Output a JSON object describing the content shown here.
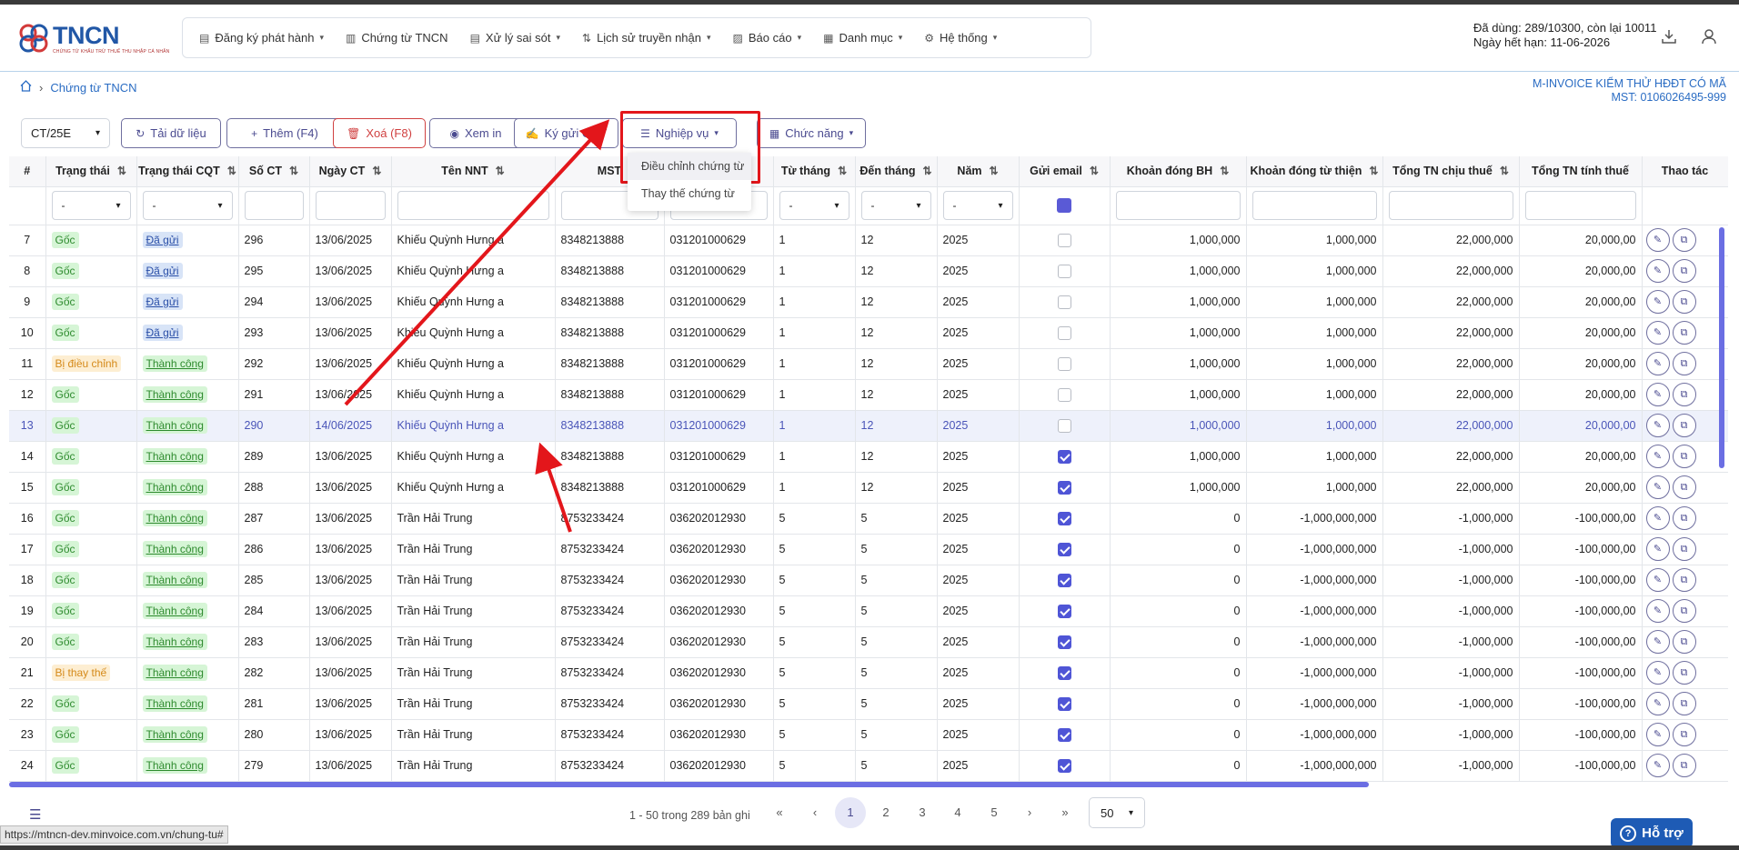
{
  "logo": {
    "text": "TNCN",
    "tagline": "CHỨNG TỪ KHẤU TRỪ THUẾ THU NHẬP CÁ NHÂN"
  },
  "nav": [
    {
      "label": "Đăng ký phát hành",
      "icon": "file-icon",
      "chevron": true
    },
    {
      "label": "Chứng từ TNCN",
      "icon": "document-icon",
      "chevron": false
    },
    {
      "label": "Xử lý sai sót",
      "icon": "file-icon",
      "chevron": true
    },
    {
      "label": "Lịch sử truyền nhận",
      "icon": "transfer-icon",
      "chevron": true
    },
    {
      "label": "Báo cáo",
      "icon": "chart-icon",
      "chevron": true
    },
    {
      "label": "Danh mục",
      "icon": "grid-icon",
      "chevron": true
    },
    {
      "label": "Hệ thống",
      "icon": "gear-icon",
      "chevron": true
    }
  ],
  "usage": {
    "line1": "Đã dùng: 289/10300, còn lại 10011",
    "line2": "Ngày hết hạn: 11-06-2026"
  },
  "breadcrumb": {
    "current": "Chứng từ TNCN"
  },
  "company": {
    "name": "M-INVOICE KIỂM THỬ HĐĐT CÓ MÃ",
    "mst": "MST: 0106026495-999"
  },
  "toolbar": {
    "type_select": "CT/25E",
    "reload": "Tải dữ liệu",
    "add": "Thêm (F4)",
    "delete": "Xoá (F8)",
    "print": "Xem in",
    "sign_send": "Ký gửi CQT",
    "business": "Nghiệp vụ",
    "functions": "Chức năng"
  },
  "dropdown": {
    "items": [
      "Điều chỉnh chứng từ",
      "Thay thế chứng từ"
    ]
  },
  "columns": [
    "#",
    "Trạng thái",
    "Trạng thái CQT",
    "Số CT",
    "Ngày CT",
    "Tên NNT",
    "MST",
    "",
    "Từ tháng",
    "Đến tháng",
    "Năm",
    "Gửi email",
    "Khoản đóng BH",
    "Khoản đóng từ thiện",
    "Tổng TN chịu thuế",
    "Tổng TN tính thuế",
    "Thao tác"
  ],
  "filter_placeholder": "-",
  "rows": [
    {
      "no": "7",
      "status": "Gốc",
      "cqt": "Đã gửi",
      "so": "296",
      "ngay": "13/06/2025",
      "ten": "Khiếu Quỳnh Hưng a",
      "mst": "8348213888",
      "cccd": "031201000629",
      "tu": "1",
      "den": "12",
      "nam": "2025",
      "email": false,
      "bh": "1,000,000",
      "tt": "1,000,000",
      "chiu": "22,000,000",
      "tinh": "20,000,00"
    },
    {
      "no": "8",
      "status": "Gốc",
      "cqt": "Đã gửi",
      "so": "295",
      "ngay": "13/06/2025",
      "ten": "Khiếu Quỳnh Hưng a",
      "mst": "8348213888",
      "cccd": "031201000629",
      "tu": "1",
      "den": "12",
      "nam": "2025",
      "email": false,
      "bh": "1,000,000",
      "tt": "1,000,000",
      "chiu": "22,000,000",
      "tinh": "20,000,00"
    },
    {
      "no": "9",
      "status": "Gốc",
      "cqt": "Đã gửi",
      "so": "294",
      "ngay": "13/06/2025",
      "ten": "Khiếu Quỳnh Hưng a",
      "mst": "8348213888",
      "cccd": "031201000629",
      "tu": "1",
      "den": "12",
      "nam": "2025",
      "email": false,
      "bh": "1,000,000",
      "tt": "1,000,000",
      "chiu": "22,000,000",
      "tinh": "20,000,00"
    },
    {
      "no": "10",
      "status": "Gốc",
      "cqt": "Đã gửi",
      "so": "293",
      "ngay": "13/06/2025",
      "ten": "Khiếu Quỳnh Hưng a",
      "mst": "8348213888",
      "cccd": "031201000629",
      "tu": "1",
      "den": "12",
      "nam": "2025",
      "email": false,
      "bh": "1,000,000",
      "tt": "1,000,000",
      "chiu": "22,000,000",
      "tinh": "20,000,00"
    },
    {
      "no": "11",
      "status": "Bị điều chỉnh",
      "cqt": "Thành công",
      "so": "292",
      "ngay": "13/06/2025",
      "ten": "Khiếu Quỳnh Hưng a",
      "mst": "8348213888",
      "cccd": "031201000629",
      "tu": "1",
      "den": "12",
      "nam": "2025",
      "email": false,
      "bh": "1,000,000",
      "tt": "1,000,000",
      "chiu": "22,000,000",
      "tinh": "20,000,00"
    },
    {
      "no": "12",
      "status": "Gốc",
      "cqt": "Thành công",
      "so": "291",
      "ngay": "13/06/2025",
      "ten": "Khiếu Quỳnh Hưng a",
      "mst": "8348213888",
      "cccd": "031201000629",
      "tu": "1",
      "den": "12",
      "nam": "2025",
      "email": false,
      "bh": "1,000,000",
      "tt": "1,000,000",
      "chiu": "22,000,000",
      "tinh": "20,000,00"
    },
    {
      "no": "13",
      "status": "Gốc",
      "cqt": "Thành công",
      "so": "290",
      "ngay": "14/06/2025",
      "ten": "Khiếu Quỳnh Hưng a",
      "mst": "8348213888",
      "cccd": "031201000629",
      "tu": "1",
      "den": "12",
      "nam": "2025",
      "email": false,
      "bh": "1,000,000",
      "tt": "1,000,000",
      "chiu": "22,000,000",
      "tinh": "20,000,00",
      "selected": true
    },
    {
      "no": "14",
      "status": "Gốc",
      "cqt": "Thành công",
      "so": "289",
      "ngay": "13/06/2025",
      "ten": "Khiếu Quỳnh Hưng a",
      "mst": "8348213888",
      "cccd": "031201000629",
      "tu": "1",
      "den": "12",
      "nam": "2025",
      "email": true,
      "bh": "1,000,000",
      "tt": "1,000,000",
      "chiu": "22,000,000",
      "tinh": "20,000,00"
    },
    {
      "no": "15",
      "status": "Gốc",
      "cqt": "Thành công",
      "so": "288",
      "ngay": "13/06/2025",
      "ten": "Khiếu Quỳnh Hưng a",
      "mst": "8348213888",
      "cccd": "031201000629",
      "tu": "1",
      "den": "12",
      "nam": "2025",
      "email": true,
      "bh": "1,000,000",
      "tt": "1,000,000",
      "chiu": "22,000,000",
      "tinh": "20,000,00"
    },
    {
      "no": "16",
      "status": "Gốc",
      "cqt": "Thành công",
      "so": "287",
      "ngay": "13/06/2025",
      "ten": "Trần Hải Trung",
      "mst": "8753233424",
      "cccd": "036202012930",
      "tu": "5",
      "den": "5",
      "nam": "2025",
      "email": true,
      "bh": "0",
      "tt": "-1,000,000,000",
      "chiu": "-1,000,000",
      "tinh": "-100,000,00"
    },
    {
      "no": "17",
      "status": "Gốc",
      "cqt": "Thành công",
      "so": "286",
      "ngay": "13/06/2025",
      "ten": "Trần Hải Trung",
      "mst": "8753233424",
      "cccd": "036202012930",
      "tu": "5",
      "den": "5",
      "nam": "2025",
      "email": true,
      "bh": "0",
      "tt": "-1,000,000,000",
      "chiu": "-1,000,000",
      "tinh": "-100,000,00"
    },
    {
      "no": "18",
      "status": "Gốc",
      "cqt": "Thành công",
      "so": "285",
      "ngay": "13/06/2025",
      "ten": "Trần Hải Trung",
      "mst": "8753233424",
      "cccd": "036202012930",
      "tu": "5",
      "den": "5",
      "nam": "2025",
      "email": true,
      "bh": "0",
      "tt": "-1,000,000,000",
      "chiu": "-1,000,000",
      "tinh": "-100,000,00"
    },
    {
      "no": "19",
      "status": "Gốc",
      "cqt": "Thành công",
      "so": "284",
      "ngay": "13/06/2025",
      "ten": "Trần Hải Trung",
      "mst": "8753233424",
      "cccd": "036202012930",
      "tu": "5",
      "den": "5",
      "nam": "2025",
      "email": true,
      "bh": "0",
      "tt": "-1,000,000,000",
      "chiu": "-1,000,000",
      "tinh": "-100,000,00"
    },
    {
      "no": "20",
      "status": "Gốc",
      "cqt": "Thành công",
      "so": "283",
      "ngay": "13/06/2025",
      "ten": "Trần Hải Trung",
      "mst": "8753233424",
      "cccd": "036202012930",
      "tu": "5",
      "den": "5",
      "nam": "2025",
      "email": true,
      "bh": "0",
      "tt": "-1,000,000,000",
      "chiu": "-1,000,000",
      "tinh": "-100,000,00"
    },
    {
      "no": "21",
      "status": "Bị thay thế",
      "cqt": "Thành công",
      "so": "282",
      "ngay": "13/06/2025",
      "ten": "Trần Hải Trung",
      "mst": "8753233424",
      "cccd": "036202012930",
      "tu": "5",
      "den": "5",
      "nam": "2025",
      "email": true,
      "bh": "0",
      "tt": "-1,000,000,000",
      "chiu": "-1,000,000",
      "tinh": "-100,000,00"
    },
    {
      "no": "22",
      "status": "Gốc",
      "cqt": "Thành công",
      "so": "281",
      "ngay": "13/06/2025",
      "ten": "Trần Hải Trung",
      "mst": "8753233424",
      "cccd": "036202012930",
      "tu": "5",
      "den": "5",
      "nam": "2025",
      "email": true,
      "bh": "0",
      "tt": "-1,000,000,000",
      "chiu": "-1,000,000",
      "tinh": "-100,000,00"
    },
    {
      "no": "23",
      "status": "Gốc",
      "cqt": "Thành công",
      "so": "280",
      "ngay": "13/06/2025",
      "ten": "Trần Hải Trung",
      "mst": "8753233424",
      "cccd": "036202012930",
      "tu": "5",
      "den": "5",
      "nam": "2025",
      "email": true,
      "bh": "0",
      "tt": "-1,000,000,000",
      "chiu": "-1,000,000",
      "tinh": "-100,000,00"
    },
    {
      "no": "24",
      "status": "Gốc",
      "cqt": "Thành công",
      "so": "279",
      "ngay": "13/06/2025",
      "ten": "Trần Hải Trung",
      "mst": "8753233424",
      "cccd": "036202012930",
      "tu": "5",
      "den": "5",
      "nam": "2025",
      "email": true,
      "bh": "0",
      "tt": "-1,000,000,000",
      "chiu": "-1,000,000",
      "tinh": "-100,000,00"
    }
  ],
  "pager": {
    "info": "1 - 50 trong 289 bản ghi",
    "pages": [
      "1",
      "2",
      "3",
      "4",
      "5"
    ],
    "current": "1",
    "size": "50"
  },
  "status_url": "https://mtncn-dev.minvoice.com.vn/chung-tu#",
  "help": {
    "label": "Hỗ trợ"
  },
  "colors": {
    "accent": "#4b4b90",
    "highlight": "#e3161b",
    "brand": "#2157a6"
  }
}
